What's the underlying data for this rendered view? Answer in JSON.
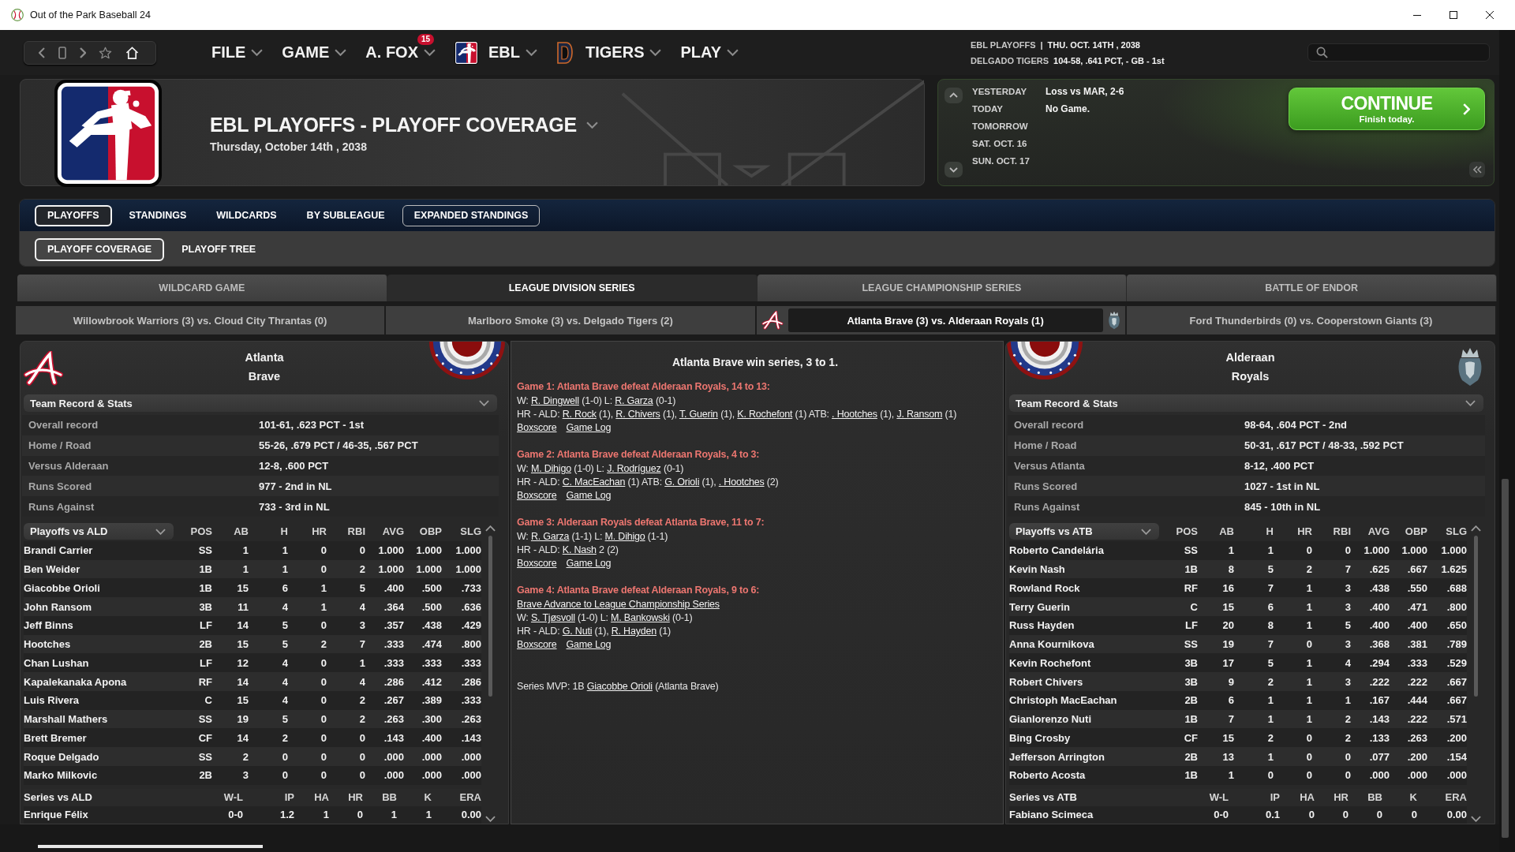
{
  "window": {
    "title": "Out of the Park Baseball 24"
  },
  "toolbar": {
    "menus": [
      {
        "label": "FILE",
        "kind": "plain"
      },
      {
        "label": "GAME",
        "kind": "plain"
      },
      {
        "label": "A. FOX",
        "kind": "plain",
        "badge": "15"
      },
      {
        "label": "EBL",
        "kind": "league"
      },
      {
        "label": "TIGERS",
        "kind": "team"
      },
      {
        "label": "PLAY",
        "kind": "plain"
      }
    ]
  },
  "status": [
    {
      "label": "EBL PLAYOFFS",
      "separator": "|",
      "value": "THU. OCT. 14TH , 2038"
    },
    {
      "label": "DELGADO TIGERS",
      "value": "104-58, .641 PCT, - GB - 1st"
    }
  ],
  "header": {
    "title": "EBL PLAYOFFS - PLAYOFF COVERAGE",
    "date": "Thursday, October 14th , 2038"
  },
  "calendar": {
    "days": [
      {
        "label": "YESTERDAY",
        "result": "Loss vs MAR, 2-6"
      },
      {
        "label": "TODAY",
        "result": "No Game."
      },
      {
        "label": "TOMORROW"
      },
      {
        "label": "SAT. OCT. 16"
      },
      {
        "label": "SUN. OCT. 17"
      }
    ],
    "continue_button": {
      "label": "CONTINUE",
      "sublabel": "Finish today."
    }
  },
  "tabs": [
    {
      "label": "PLAYOFFS",
      "selected": true,
      "hovered": false
    },
    {
      "label": "STANDINGS",
      "selected": false,
      "hovered": false
    },
    {
      "label": "WILDCARDS",
      "selected": false,
      "hovered": false
    },
    {
      "label": "BY SUBLEAGUE",
      "selected": false,
      "hovered": false
    },
    {
      "label": "EXPANDED STANDINGS",
      "selected": false,
      "hovered": true
    }
  ],
  "subtabs": [
    {
      "label": "PLAYOFF COVERAGE",
      "selected": true
    },
    {
      "label": "PLAYOFF TREE",
      "selected": false
    }
  ],
  "rounds": [
    {
      "label": "WILDCARD GAME",
      "selected": false
    },
    {
      "label": "LEAGUE DIVISION SERIES",
      "selected": true
    },
    {
      "label": "LEAGUE CHAMPIONSHIP SERIES",
      "selected": false
    },
    {
      "label": "BATTLE OF ENDOR",
      "selected": false
    }
  ],
  "series": [
    {
      "label": "Willowbrook Warriors (3) vs. Cloud City Thrantas (0)",
      "selected": false
    },
    {
      "label": "Marlboro Smoke (3) vs. Delgado Tigers (2)",
      "selected": false
    },
    {
      "label": "Atlanta Brave (3) vs. Alderaan Royals (1)",
      "selected": true
    },
    {
      "label": "Ford Thunderbirds (0) vs. Cooperstown Giants (3)",
      "selected": false
    }
  ],
  "teams": [
    {
      "city": "Atlanta",
      "name": "Brave",
      "record_title": "Team Record & Stats",
      "record": [
        {
          "label": "Overall record",
          "value": "101-61, .623 PCT - 1st"
        },
        {
          "label": "Home / Road",
          "value": "55-26, .679 PCT / 46-35, .567 PCT"
        },
        {
          "label": "Versus Alderaan",
          "value": "12-8, .600 PCT"
        },
        {
          "label": "Runs Scored",
          "value": "977 - 2nd in NL"
        },
        {
          "label": "Runs Against",
          "value": "733 - 3rd in NL"
        }
      ],
      "batting": {
        "columns": [
          "Playoffs vs ALD",
          "POS",
          "AB",
          "H",
          "HR",
          "RBI",
          "AVG",
          "OBP",
          "SLG"
        ],
        "rows": [
          [
            "Brandi Carrier",
            "SS",
            "1",
            "1",
            "0",
            "0",
            "1.000",
            "1.000",
            "1.000"
          ],
          [
            "Ben Weider",
            "1B",
            "1",
            "1",
            "0",
            "2",
            "1.000",
            "1.000",
            "1.000"
          ],
          [
            "Giacobbe Orioli",
            "1B",
            "15",
            "6",
            "1",
            "5",
            ".400",
            ".500",
            ".733"
          ],
          [
            "John Ransom",
            "3B",
            "11",
            "4",
            "1",
            "4",
            ".364",
            ".500",
            ".636"
          ],
          [
            "Jeff Binns",
            "LF",
            "14",
            "5",
            "0",
            "3",
            ".357",
            ".438",
            ".429"
          ],
          [
            "Hootches",
            "2B",
            "15",
            "5",
            "2",
            "7",
            ".333",
            ".474",
            ".800"
          ],
          [
            "Chan Lushan",
            "LF",
            "12",
            "4",
            "0",
            "1",
            ".333",
            ".333",
            ".333"
          ],
          [
            "Kapalekanaka Apona",
            "RF",
            "14",
            "4",
            "0",
            "4",
            ".286",
            ".412",
            ".286"
          ],
          [
            "Luis Rivera",
            "C",
            "15",
            "4",
            "0",
            "2",
            ".267",
            ".389",
            ".333"
          ],
          [
            "Marshall Mathers",
            "SS",
            "19",
            "5",
            "0",
            "2",
            ".263",
            ".300",
            ".263"
          ],
          [
            "Brett Bremer",
            "CF",
            "14",
            "2",
            "0",
            "0",
            ".143",
            ".400",
            ".143"
          ],
          [
            "Roque Delgado",
            "SS",
            "2",
            "0",
            "0",
            "0",
            ".000",
            ".000",
            ".000"
          ],
          [
            "Marko Milkovic",
            "2B",
            "3",
            "0",
            "0",
            "0",
            ".000",
            ".000",
            ".000"
          ]
        ]
      },
      "pitching": {
        "columns": [
          "Series vs ALD",
          "W-L",
          "IP",
          "HA",
          "HR",
          "BB",
          "K",
          "ERA"
        ],
        "rows": [
          [
            "Enrique Félix",
            "0-0",
            "1.2",
            "1",
            "0",
            "1",
            "1",
            "0.00"
          ]
        ]
      }
    },
    {
      "city": "Alderaan",
      "name": "Royals",
      "record_title": "Team Record & Stats",
      "record": [
        {
          "label": "Overall record",
          "value": "98-64, .604 PCT - 2nd"
        },
        {
          "label": "Home / Road",
          "value": "50-31, .617 PCT / 48-33, .592 PCT"
        },
        {
          "label": "Versus Atlanta",
          "value": "8-12, .400 PCT"
        },
        {
          "label": "Runs Scored",
          "value": "1027 - 1st in NL"
        },
        {
          "label": "Runs Against",
          "value": "845 - 10th in NL"
        }
      ],
      "batting": {
        "columns": [
          "Playoffs vs ATB",
          "POS",
          "AB",
          "H",
          "HR",
          "RBI",
          "AVG",
          "OBP",
          "SLG"
        ],
        "rows": [
          [
            "Roberto Candelária",
            "SS",
            "1",
            "1",
            "0",
            "0",
            "1.000",
            "1.000",
            "1.000"
          ],
          [
            "Kevin Nash",
            "1B",
            "8",
            "5",
            "2",
            "7",
            ".625",
            ".667",
            "1.625"
          ],
          [
            "Rowland Rock",
            "RF",
            "16",
            "7",
            "1",
            "3",
            ".438",
            ".550",
            ".688"
          ],
          [
            "Terry Guerin",
            "C",
            "15",
            "6",
            "1",
            "3",
            ".400",
            ".471",
            ".800"
          ],
          [
            "Russ Hayden",
            "LF",
            "20",
            "8",
            "1",
            "5",
            ".400",
            ".400",
            ".650"
          ],
          [
            "Anna Kournikova",
            "SS",
            "19",
            "7",
            "0",
            "3",
            ".368",
            ".381",
            ".789"
          ],
          [
            "Kevin Rochefont",
            "3B",
            "17",
            "5",
            "1",
            "4",
            ".294",
            ".333",
            ".529"
          ],
          [
            "Robert Chivers",
            "3B",
            "9",
            "2",
            "1",
            "3",
            ".222",
            ".222",
            ".667"
          ],
          [
            "Christoph MacEachan",
            "2B",
            "6",
            "1",
            "1",
            "1",
            ".167",
            ".444",
            ".667"
          ],
          [
            "Gianlorenzo Nuti",
            "1B",
            "7",
            "1",
            "1",
            "2",
            ".143",
            ".222",
            ".571"
          ],
          [
            "Bing Crosby",
            "CF",
            "15",
            "2",
            "0",
            "2",
            ".133",
            ".263",
            ".200"
          ],
          [
            "Jefferson Arrington",
            "2B",
            "13",
            "1",
            "0",
            "0",
            ".077",
            ".200",
            ".154"
          ],
          [
            "Roberto Acosta",
            "1B",
            "1",
            "0",
            "0",
            "0",
            ".000",
            ".000",
            ".000"
          ]
        ]
      },
      "pitching": {
        "columns": [
          "Series vs ATB",
          "W-L",
          "IP",
          "HA",
          "HR",
          "BB",
          "K",
          "ERA"
        ],
        "rows": [
          [
            "Fabiano Scimeca",
            "0-0",
            "0.1",
            "0",
            "0",
            "0",
            "0",
            "0.00"
          ]
        ]
      }
    }
  ],
  "summary": {
    "title": "Atlanta Brave win series, 3 to 1.",
    "games": [
      {
        "heading": "Game 1: Atlanta Brave defeat Alderaan Royals, 14 to 13:",
        "lines": [
          [
            {
              "kind": "text",
              "text": "W: "
            },
            {
              "kind": "link",
              "text": "R. Dingwell"
            },
            {
              "kind": "text",
              "text": " (1-0) L: "
            },
            {
              "kind": "link",
              "text": "R. Garza"
            },
            {
              "kind": "text",
              "text": " (0-1)"
            }
          ],
          [
            {
              "kind": "text",
              "text": "HR - ALD: "
            },
            {
              "kind": "link",
              "text": "R. Rock"
            },
            {
              "kind": "text",
              "text": " (1), "
            },
            {
              "kind": "link",
              "text": "R. Chivers"
            },
            {
              "kind": "text",
              "text": " (1), "
            },
            {
              "kind": "link",
              "text": "T. Guerin"
            },
            {
              "kind": "text",
              "text": " (1), "
            },
            {
              "kind": "link",
              "text": "K. Rochefont"
            },
            {
              "kind": "text",
              "text": " (1) ATB: "
            },
            {
              "kind": "link",
              "text": ". Hootches"
            },
            {
              "kind": "text",
              "text": " (1), "
            },
            {
              "kind": "link",
              "text": "J. Ransom"
            },
            {
              "kind": "text",
              "text": " (1)"
            }
          ]
        ],
        "links": [
          "Boxscore",
          "Game Log"
        ]
      },
      {
        "heading": "Game 2: Atlanta Brave defeat Alderaan Royals, 4 to 3:",
        "lines": [
          [
            {
              "kind": "text",
              "text": "W: "
            },
            {
              "kind": "link",
              "text": "M. Dihigo"
            },
            {
              "kind": "text",
              "text": " (1-0) L: "
            },
            {
              "kind": "link",
              "text": "J. Rodríguez"
            },
            {
              "kind": "text",
              "text": " (0-1)"
            }
          ],
          [
            {
              "kind": "text",
              "text": "HR - ALD: "
            },
            {
              "kind": "link",
              "text": "C. MacEachan"
            },
            {
              "kind": "text",
              "text": " (1) ATB: "
            },
            {
              "kind": "link",
              "text": "G. Orioli"
            },
            {
              "kind": "text",
              "text": " (1), "
            },
            {
              "kind": "link",
              "text": ". Hootches"
            },
            {
              "kind": "text",
              "text": " (2)"
            }
          ]
        ],
        "links": [
          "Boxscore",
          "Game Log"
        ]
      },
      {
        "heading": "Game 3: Alderaan Royals defeat Atlanta Brave, 11 to 7:",
        "lines": [
          [
            {
              "kind": "text",
              "text": "W: "
            },
            {
              "kind": "link",
              "text": "R. Garza"
            },
            {
              "kind": "text",
              "text": " (1-1) L: "
            },
            {
              "kind": "link",
              "text": "M. Dihigo"
            },
            {
              "kind": "text",
              "text": " (1-1)"
            }
          ],
          [
            {
              "kind": "text",
              "text": "HR - ALD: "
            },
            {
              "kind": "link",
              "text": "K. Nash"
            },
            {
              "kind": "text",
              "text": " 2 (2)"
            }
          ]
        ],
        "links": [
          "Boxscore",
          "Game Log"
        ]
      },
      {
        "heading": "Game 4: Atlanta Brave defeat Alderaan Royals, 9 to 6:",
        "lines": [
          [
            {
              "kind": "link",
              "text": "Brave Advance to League Championship Series"
            }
          ],
          [
            {
              "kind": "text",
              "text": "W: "
            },
            {
              "kind": "link",
              "text": "S. Tjøsvoll"
            },
            {
              "kind": "text",
              "text": " (1-0) L: "
            },
            {
              "kind": "link",
              "text": "M. Bankowski"
            },
            {
              "kind": "text",
              "text": " (0-1)"
            }
          ],
          [
            {
              "kind": "text",
              "text": "HR - ALD: "
            },
            {
              "kind": "link",
              "text": "G. Nuti"
            },
            {
              "kind": "text",
              "text": " (1), "
            },
            {
              "kind": "link",
              "text": "R. Hayden"
            },
            {
              "kind": "text",
              "text": " (1)"
            }
          ]
        ],
        "links": [
          "Boxscore",
          "Game Log"
        ]
      }
    ],
    "mvp": [
      {
        "kind": "text",
        "text": "Series MVP: 1B "
      },
      {
        "kind": "link",
        "text": "Giacobbe Orioli"
      },
      {
        "kind": "text",
        "text": " (Atlanta Brave)"
      }
    ]
  }
}
